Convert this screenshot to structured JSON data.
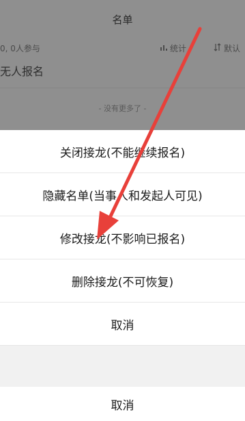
{
  "background": {
    "title": "名单",
    "meta_left": "0, 0人参与",
    "stats_label": "统计",
    "default_label": "默认",
    "empty_text": "无人报名",
    "no_more": "- 没有更多了 -"
  },
  "action_sheet": {
    "items": [
      {
        "label": "关闭接龙(不能继续报名)"
      },
      {
        "label": "隐藏名单(当事人和发起人可见)"
      },
      {
        "label": "修改接龙(不影响已报名)"
      },
      {
        "label": "删除接龙(不可恢复)"
      },
      {
        "label": "取消"
      }
    ],
    "cancel_label": "取消"
  },
  "annotation": {
    "arrow_color": "#e8403a"
  },
  "colors": {
    "overlay": "#8f8f8f",
    "sheet_bg": "#ffffff",
    "gap_bg": "#f1f1f1"
  }
}
